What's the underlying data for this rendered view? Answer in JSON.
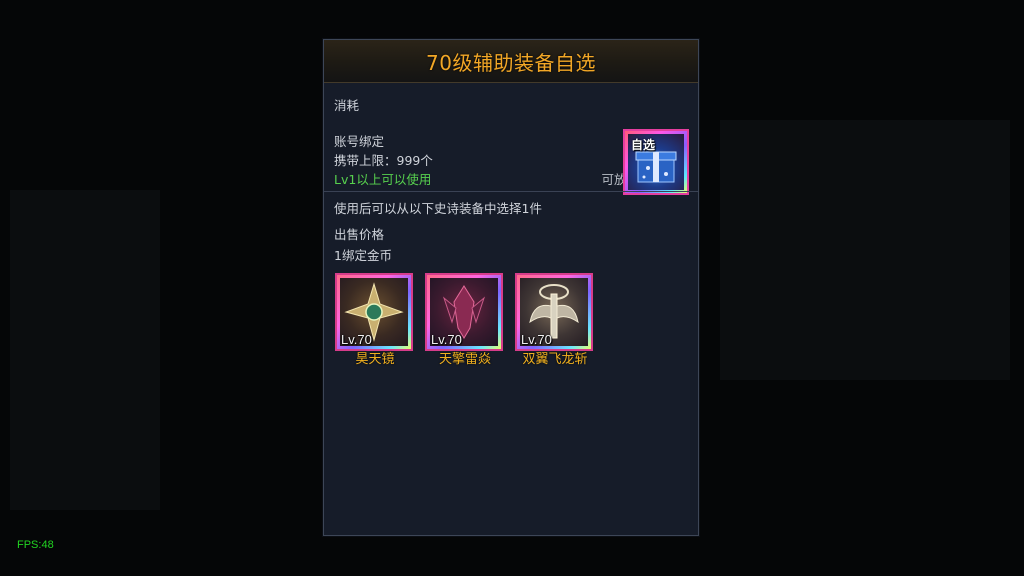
{
  "fps": "FPS:48",
  "dialog": {
    "title": "70级辅助装备自选",
    "item_icon_label": "自选",
    "type_label": "消耗",
    "bind_label": "账号绑定",
    "carry_limit": "携带上限：999个",
    "level_requirement": "Lv1以上可以使用",
    "storage_note": "可放入账号仓库",
    "description": "使用后可以从以下史诗装备中选择1件",
    "sell_price_label": "出售价格",
    "sell_price_value": "1绑定金币",
    "equipment": [
      {
        "name": "昊天镜",
        "level": "Lv.70"
      },
      {
        "name": "天擎雷焱",
        "level": "Lv.70"
      },
      {
        "name": "双翼飞龙斩",
        "level": "Lv.70"
      }
    ]
  },
  "colors": {
    "title": "#f2a726",
    "requirement": "#57d04e",
    "equip_name": "#f0b020",
    "fps": "#21d321"
  }
}
